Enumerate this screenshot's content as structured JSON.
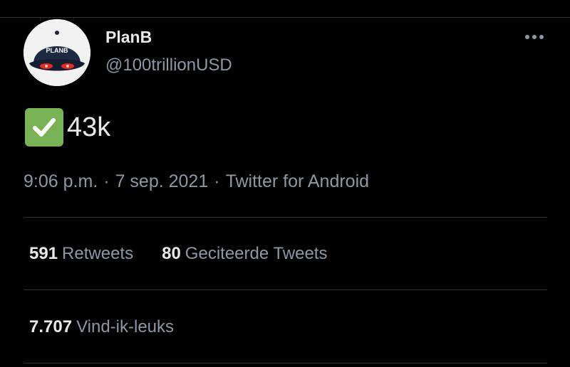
{
  "tweet": {
    "author": {
      "display_name": "PlanB",
      "handle": "@100trillionUSD",
      "avatar_cap_text": "PLANB"
    },
    "text": "43k",
    "emoji": "white-check-mark",
    "time": "9:06 p.m.",
    "date": "7 sep. 2021",
    "separator": "·",
    "source": "Twitter for Android"
  },
  "stats": {
    "retweets": {
      "count": "591",
      "label": "Retweets"
    },
    "quotes": {
      "count": "80",
      "label": "Geciteerde Tweets"
    },
    "likes": {
      "count": "7.707",
      "label": "Vind-ik-leuks"
    }
  },
  "icons": {
    "more": "more-horizontal-icon",
    "check": "check-mark-icon"
  },
  "colors": {
    "background": "#000000",
    "primary_text": "#e7e9ea",
    "secondary_text": "#8b98a5",
    "divider": "#2f3336",
    "check_green": "#77b255"
  }
}
